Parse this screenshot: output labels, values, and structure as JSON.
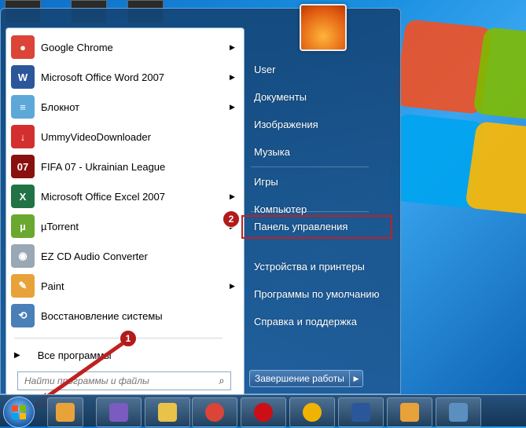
{
  "programs": [
    {
      "label": "Google Chrome",
      "icon": "chrome-icon",
      "color": "#db4437",
      "glyph": "●",
      "submenu": true
    },
    {
      "label": "Microsoft Office Word 2007",
      "icon": "word-icon",
      "color": "#2b579a",
      "glyph": "W",
      "submenu": true
    },
    {
      "label": "Блокнот",
      "icon": "notepad-icon",
      "color": "#5ea7d9",
      "glyph": "≡",
      "submenu": true
    },
    {
      "label": "UmmyVideoDownloader",
      "icon": "ummy-icon",
      "color": "#d32f2f",
      "glyph": "↓",
      "submenu": false
    },
    {
      "label": "FIFA 07 - Ukrainian League",
      "icon": "fifa-icon",
      "color": "#8a1010",
      "glyph": "07",
      "submenu": false
    },
    {
      "label": "Microsoft Office Excel 2007",
      "icon": "excel-icon",
      "color": "#217346",
      "glyph": "X",
      "submenu": true
    },
    {
      "label": "µTorrent",
      "icon": "utorrent-icon",
      "color": "#6aa82f",
      "glyph": "µ",
      "submenu": true
    },
    {
      "label": "EZ CD Audio Converter",
      "icon": "cd-icon",
      "color": "#9aa7b4",
      "glyph": "◉",
      "submenu": false
    },
    {
      "label": "Paint",
      "icon": "paint-icon",
      "color": "#e8a23a",
      "glyph": "✎",
      "submenu": true
    },
    {
      "label": "Восстановление системы",
      "icon": "system-restore-icon",
      "color": "#4a7fb8",
      "glyph": "⟲",
      "submenu": false
    }
  ],
  "all_programs": "Все программы",
  "search": {
    "placeholder": "Найти программы и файлы"
  },
  "right_items": [
    "User",
    "Документы",
    "Изображения",
    "Музыка",
    "Игры",
    "Компьютер",
    "Панель управления",
    "Устройства и принтеры",
    "Программы по умолчанию",
    "Справка и поддержка"
  ],
  "shutdown_label": "Завершение работы",
  "badges": {
    "one": "1",
    "two": "2"
  },
  "colors": {
    "highlight": "#c02020",
    "badge": "#b31a1a",
    "accent": "#1a8fe0"
  }
}
